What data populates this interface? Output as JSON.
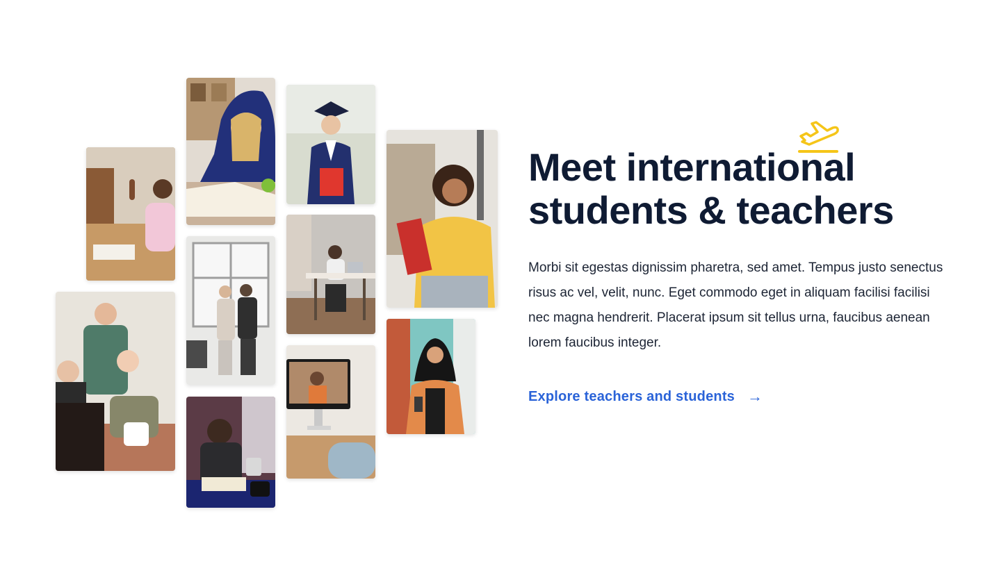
{
  "hero": {
    "title": "Meet international\nstudents & teachers",
    "body": "Morbi sit egestas dignissim pharetra, sed amet. Tempus justo senectus risus ac vel, velit, nunc. Eget commodo eget in aliquam facilisi facilisi nec magna hendrerit. Placerat ipsum sit tellus urna, faucibus aenean lorem faucibus integer.",
    "cta_label": "Explore teachers and students",
    "cta_icon": "arrow-right-icon",
    "decoration_icon": "airplane-takeoff-icon"
  },
  "colors": {
    "title": "#0f1b33",
    "body": "#1c2434",
    "link": "#2a63d8",
    "accent": "#f5c518"
  },
  "photos": [
    {
      "id": "student-raising-hand-photo"
    },
    {
      "id": "group-study-photo"
    },
    {
      "id": "girl-reading-book-photo"
    },
    {
      "id": "students-by-window-photo"
    },
    {
      "id": "student-reading-at-desk-photo"
    },
    {
      "id": "graduate-photo"
    },
    {
      "id": "woman-at-laptop-photo"
    },
    {
      "id": "video-call-teacher-photo"
    },
    {
      "id": "student-with-books-photo"
    },
    {
      "id": "student-in-hijab-photo"
    }
  ]
}
